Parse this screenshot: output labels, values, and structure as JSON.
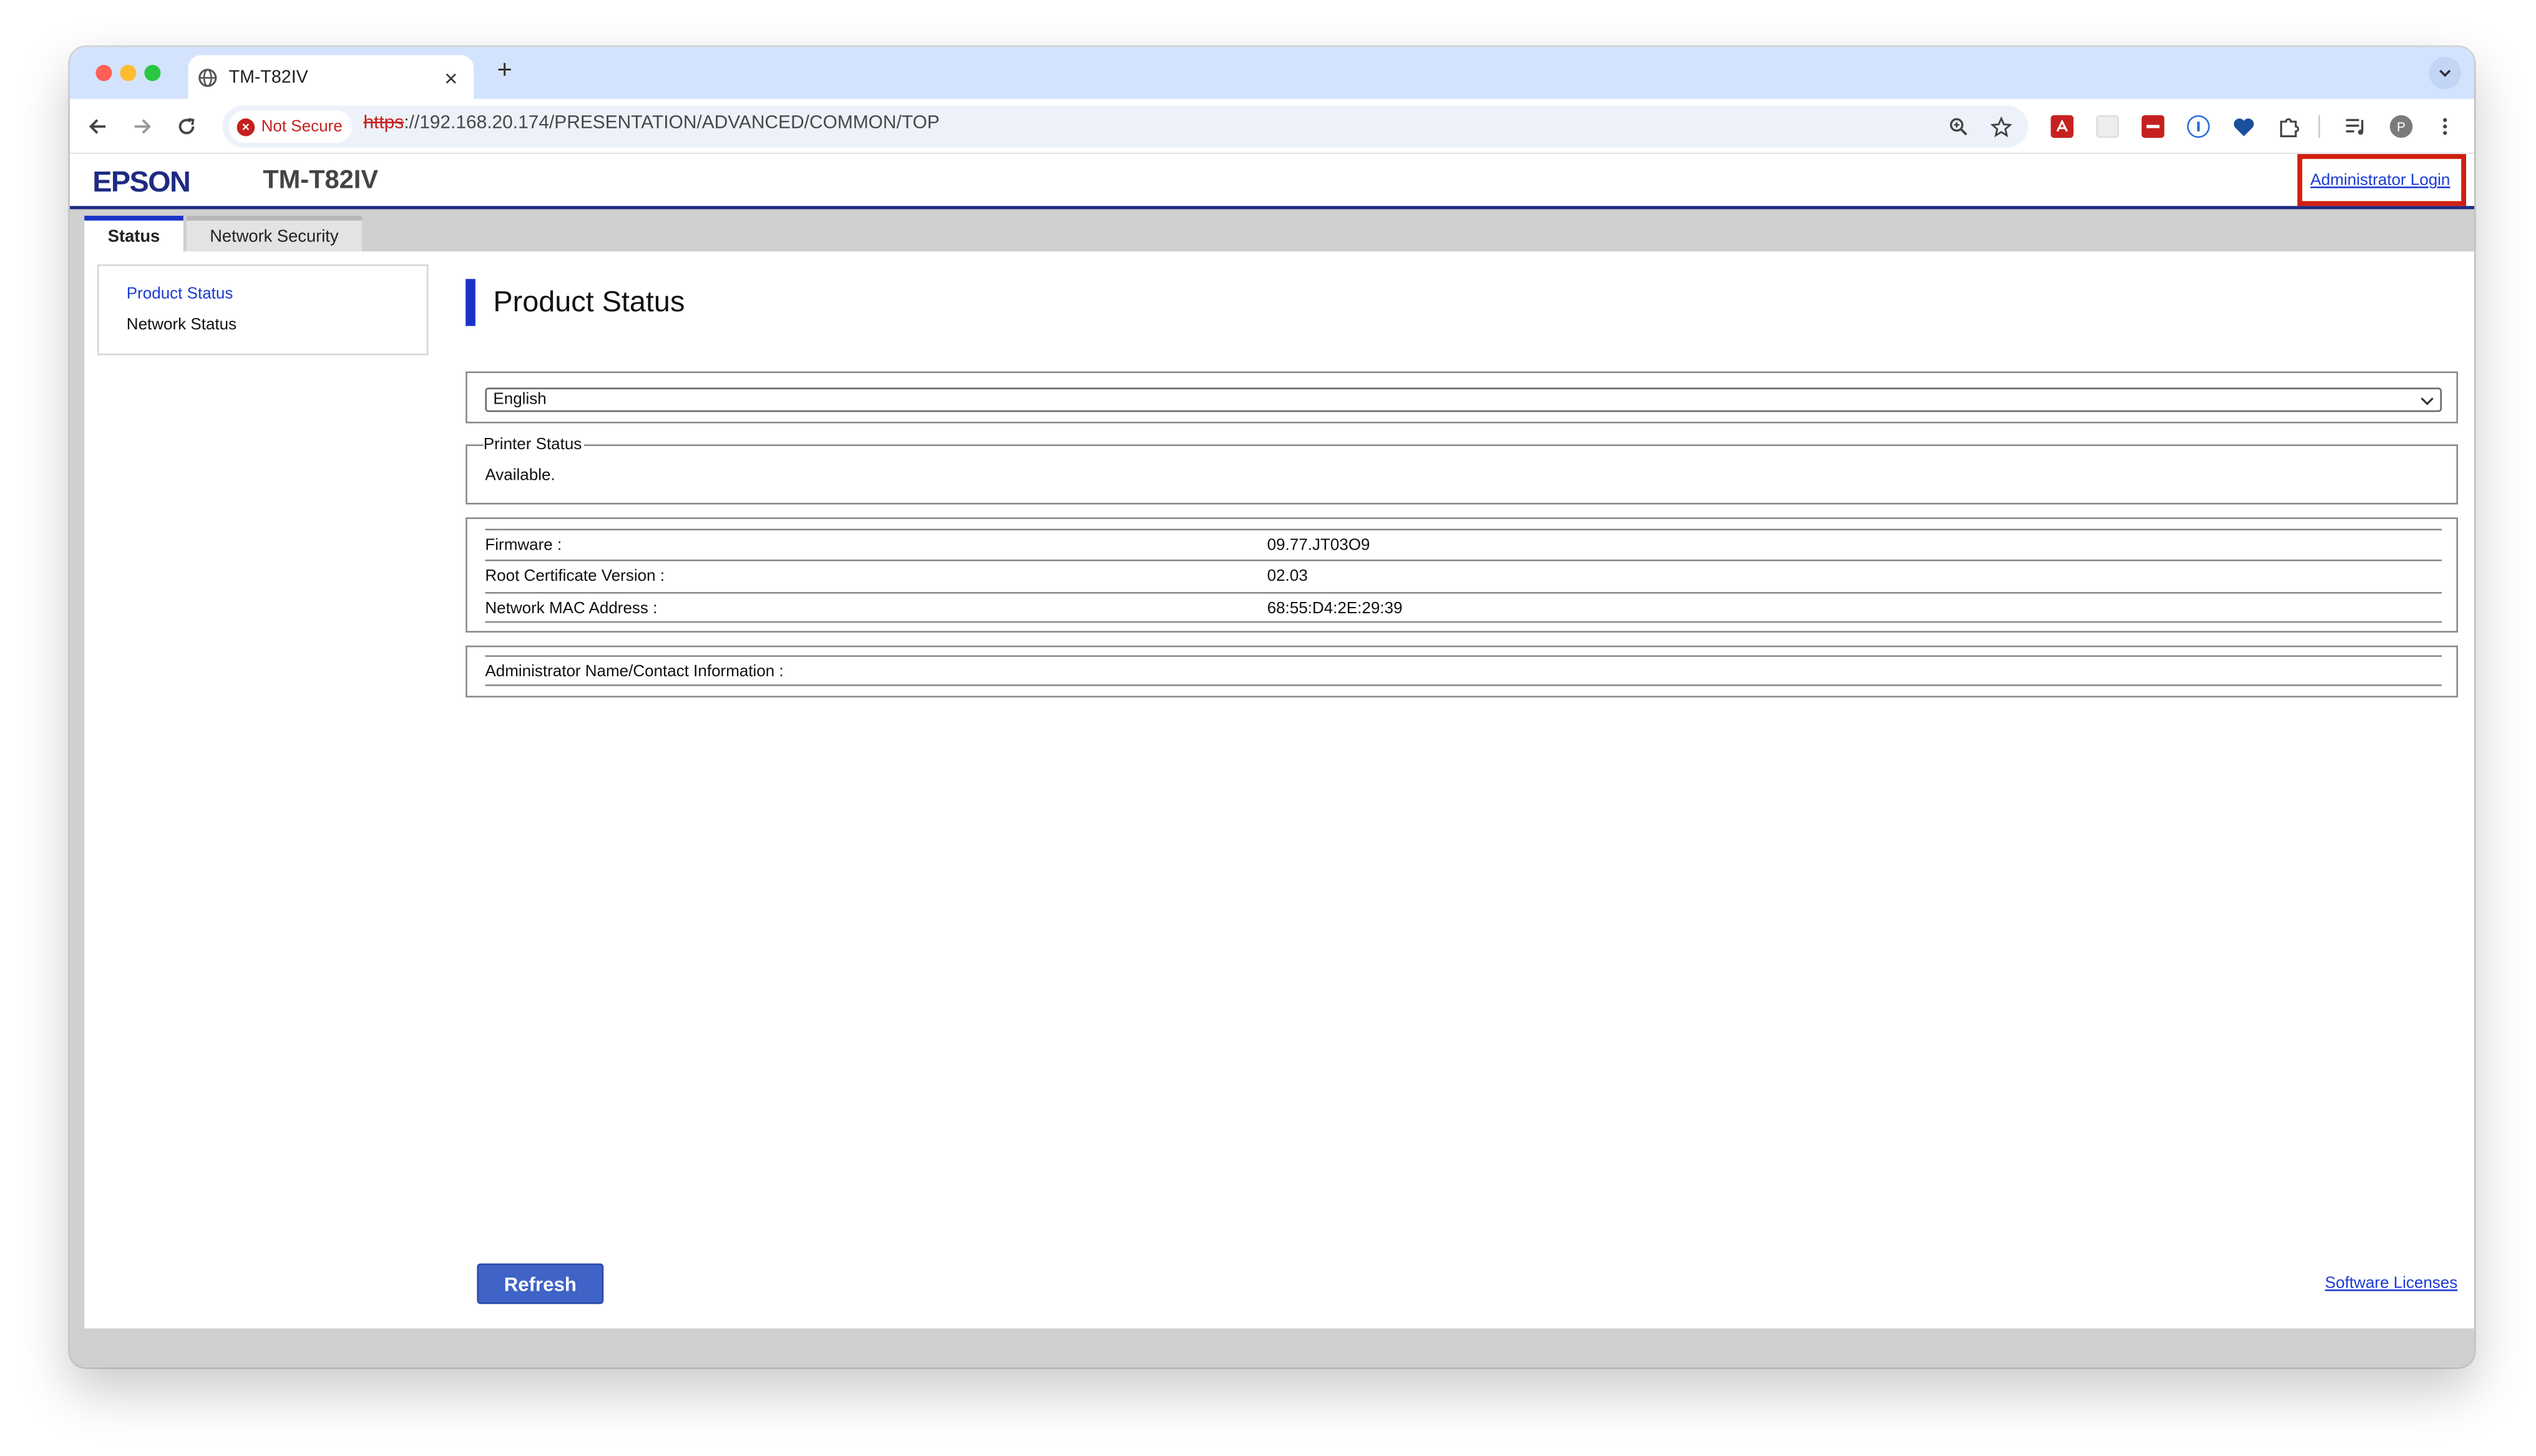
{
  "browser": {
    "tab_title": "TM-T82IV",
    "new_tab_symbol": "+",
    "close_symbol": "×",
    "security_label": "Not Secure",
    "url_scheme": "https",
    "url_rest": "://192.168.20.174/PRESENTATION/ADVANCED/COMMON/TOP",
    "profile_initial": "P"
  },
  "header": {
    "logo": "EPSON",
    "model": "TM-T82IV",
    "admin_login": "Administrator Login"
  },
  "tabs": [
    {
      "label": "Status",
      "active": true
    },
    {
      "label": "Network Security",
      "active": false
    }
  ],
  "sidebar": {
    "items": [
      {
        "label": "Product Status",
        "active": true
      },
      {
        "label": "Network Status",
        "active": false
      }
    ]
  },
  "main": {
    "title": "Product Status",
    "language": "English",
    "printer_status": {
      "legend": "Printer Status",
      "value": "Available."
    },
    "info": [
      {
        "label": "Firmware :",
        "value": "09.77.JT03O9"
      },
      {
        "label": "Root Certificate Version :",
        "value": "02.03"
      },
      {
        "label": "Network MAC Address :",
        "value": "68:55:D4:2E:29:39"
      }
    ],
    "admin_contact_label": "Administrator Name/Contact Information :",
    "refresh": "Refresh",
    "licenses": "Software Licenses"
  },
  "colors": {
    "epson_blue": "#1e2b83",
    "accent_blue": "#1932c8",
    "link": "#1b3bd1",
    "highlight_red": "#d0200f",
    "button": "#3f63c7"
  }
}
